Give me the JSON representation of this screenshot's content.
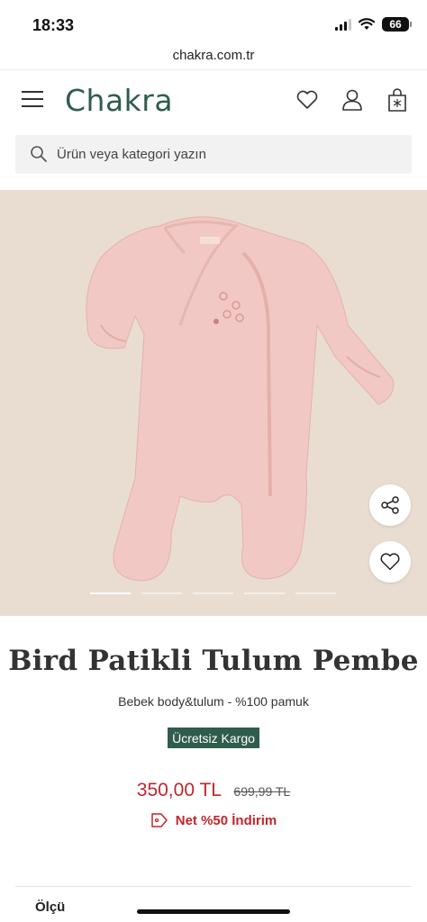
{
  "status_bar": {
    "time": "18:33",
    "battery": "66"
  },
  "browser": {
    "url": "chakra.com.tr"
  },
  "header": {
    "logo": "Chakra",
    "icons": [
      "menu-icon",
      "heart-icon",
      "user-icon",
      "shopping-bag-icon"
    ]
  },
  "search": {
    "placeholder": "Ürün veya kategori yazın"
  },
  "gallery": {
    "slide_count": 5,
    "active_slide": 1,
    "actions": [
      "share-icon",
      "heart-icon"
    ],
    "colors": {
      "background": "#e9ddd1",
      "garment": "#f2c8c4"
    }
  },
  "product": {
    "title": "Bird Patikli Tulum Pembe",
    "subtitle": "Bebek body&tulum - %100 pamuk",
    "badge": "Ücretsiz Kargo",
    "price": "350,00 TL",
    "old_price": "699,99 TL",
    "discount": "Net %50 İndirim"
  },
  "size_section": {
    "label": "Ölçü"
  },
  "colors": {
    "brand": "#2f5d4c",
    "price": "#c0262d"
  }
}
